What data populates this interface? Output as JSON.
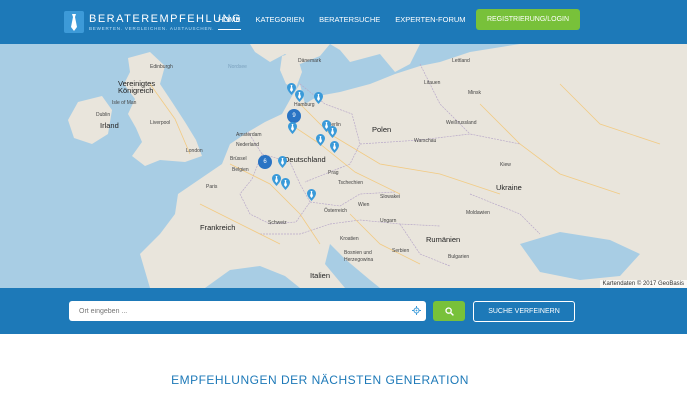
{
  "brand": {
    "name": "BERATEREMPFEHLUNG",
    "tagline": "BEWERTEN. VERGLEICHEN. AUSTAUSCHEN.",
    "icon": "tie-logo-icon"
  },
  "nav": {
    "items": [
      {
        "label": "HOME",
        "active": true
      },
      {
        "label": "KATEGORIEN",
        "active": false
      },
      {
        "label": "BERATERSUCHE",
        "active": false
      },
      {
        "label": "EXPERTEN-FORUM",
        "active": false
      }
    ],
    "register_label": "REGISTRIERUNG/LOGIN"
  },
  "map": {
    "attribution": "Kartendaten © 2017 GeoBasis",
    "labels": {
      "uk": "Vereinigtes Königreich",
      "ireland": "Irland",
      "nordsee": "Nordsee",
      "danemark": "Dänemark",
      "edinburgh": "Edinburgh",
      "isle_of_man": "Isle of Man",
      "dublin": "Dublin",
      "liverpool": "Liverpool",
      "london": "London",
      "nederland": "Nederland",
      "amsterdam": "Amsterdam",
      "belgien": "Belgien",
      "brussel": "Brüssel",
      "paris": "Paris",
      "frankreich": "Frankreich",
      "deutschland": "Deutschland",
      "berlin": "Berlin",
      "hamburg": "Hamburg",
      "polen": "Polen",
      "warschau": "Warschau",
      "tschechien": "Tschechien",
      "prag": "Prag",
      "osterreich": "Österreich",
      "wien": "Wien",
      "schweiz": "Schweiz",
      "italien": "Italien",
      "litauen": "Litauen",
      "lettland": "Lettland",
      "weissrussland": "Weißrussland",
      "minsk": "Minsk",
      "ukraine": "Ukraine",
      "kiew": "Kiew",
      "slowakei": "Slowakei",
      "ungarn": "Ungarn",
      "rumanien": "Rumänien",
      "moldawien": "Moldawien",
      "bosnien": "Bosnien und Herzegowina",
      "serbien": "Serbien",
      "bulgarien": "Bulgarien",
      "kroatien": "Kroatien"
    },
    "clusters": [
      {
        "count": "9"
      },
      {
        "count": "6"
      }
    ]
  },
  "search": {
    "placeholder": "Ort eingeben ...",
    "submit_icon": "search-icon",
    "refine_label": "SUCHE VERFEINERN"
  },
  "section": {
    "title": "EMPFEHLUNGEN DER NÄCHSTEN GENERATION"
  },
  "colors": {
    "primary": "#1d79b8",
    "accent": "#78c13a",
    "cluster": "#2a74c4",
    "marker": "#3a9ad9"
  }
}
